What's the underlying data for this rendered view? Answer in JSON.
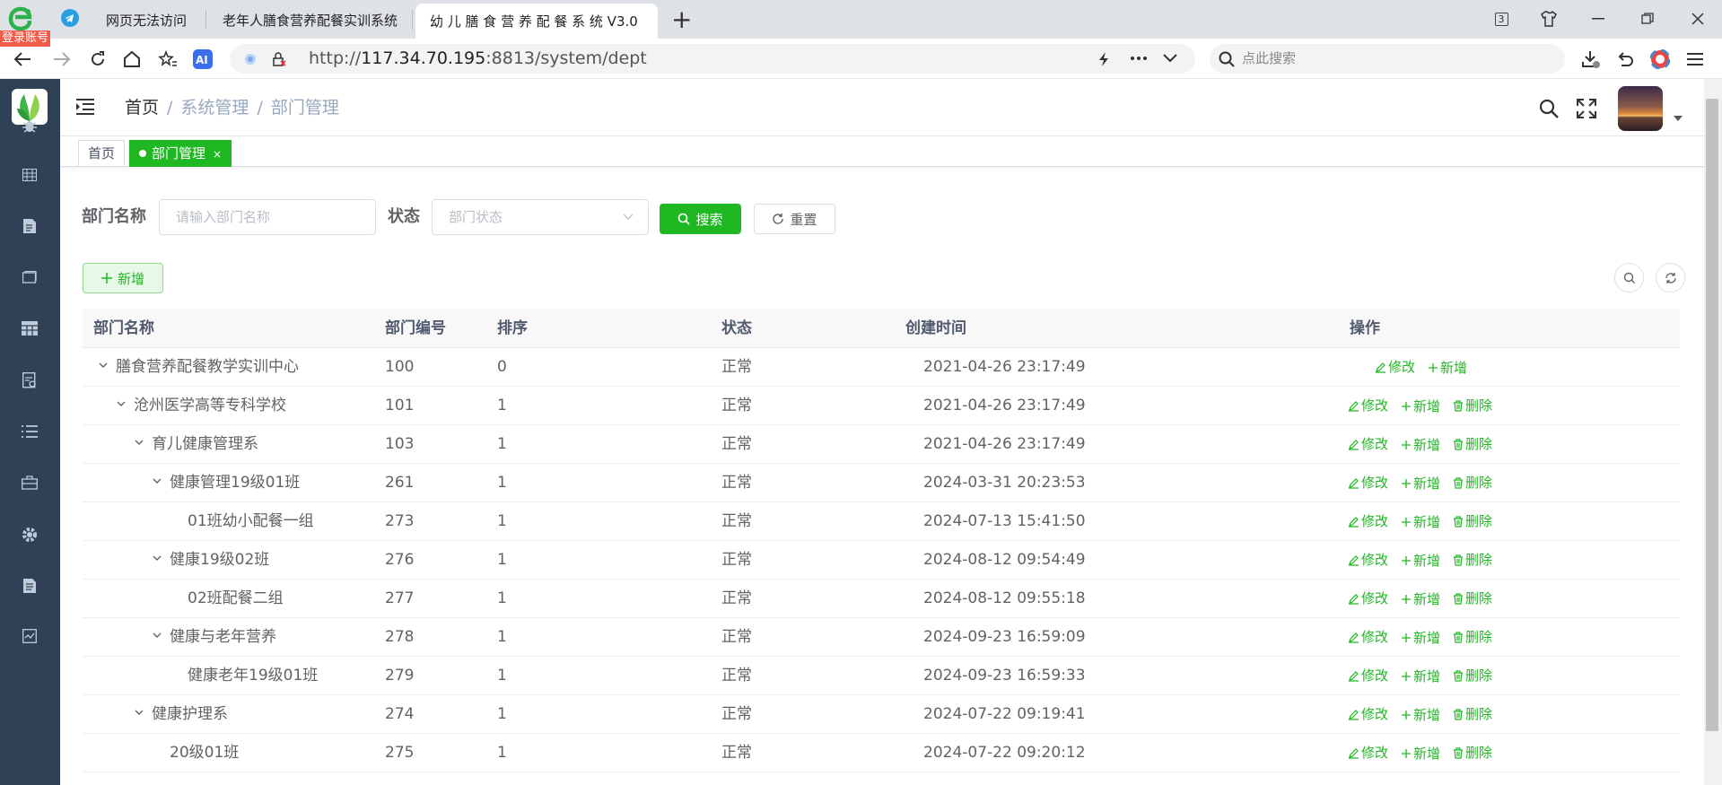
{
  "browser": {
    "login_badge": "登录账号",
    "tabs": [
      {
        "label": "网页无法访问"
      },
      {
        "label": "老年人膳食营养配餐实训系统"
      },
      {
        "label": "幼 儿 膳 食 营 养 配 餐 系 统 V3.0"
      }
    ],
    "tab_count": "3",
    "url_prefix": "http://",
    "url_host": "117.34.70.195",
    "url_rest": ":8813/system/dept",
    "search_placeholder": "点此搜索"
  },
  "breadcrumb": {
    "home": "首页",
    "sep": "/",
    "section": "系统管理",
    "page": "部门管理"
  },
  "tags": {
    "home": "首页",
    "active": "部门管理",
    "close": "×"
  },
  "form": {
    "name_label": "部门名称",
    "name_placeholder": "请输入部门名称",
    "status_label": "状态",
    "status_placeholder": "部门状态",
    "search_btn": "搜索",
    "reset_btn": "重置",
    "add_btn": "新增"
  },
  "table": {
    "headers": {
      "name": "部门名称",
      "id": "部门编号",
      "order": "排序",
      "status": "状态",
      "created": "创建时间",
      "ops": "操作"
    },
    "op_labels": {
      "edit": "修改",
      "add": "新增",
      "delete": "删除"
    },
    "rows": [
      {
        "name": "膳食营养配餐教学实训中心",
        "id": "100",
        "order": "0",
        "status": "正常",
        "created": "2021-04-26 23:17:49",
        "level": 0,
        "expanded": true,
        "can_delete": false
      },
      {
        "name": "沧州医学高等专科学校",
        "id": "101",
        "order": "1",
        "status": "正常",
        "created": "2021-04-26 23:17:49",
        "level": 1,
        "expanded": true,
        "can_delete": true
      },
      {
        "name": "育儿健康管理系",
        "id": "103",
        "order": "1",
        "status": "正常",
        "created": "2021-04-26 23:17:49",
        "level": 2,
        "expanded": true,
        "can_delete": true
      },
      {
        "name": "健康管理19级01班",
        "id": "261",
        "order": "1",
        "status": "正常",
        "created": "2024-03-31 20:23:53",
        "level": 3,
        "expanded": true,
        "can_delete": true
      },
      {
        "name": "01班幼小配餐一组",
        "id": "273",
        "order": "1",
        "status": "正常",
        "created": "2024-07-13 15:41:50",
        "level": 4,
        "expanded": false,
        "can_delete": true
      },
      {
        "name": "健康19级02班",
        "id": "276",
        "order": "1",
        "status": "正常",
        "created": "2024-08-12 09:54:49",
        "level": 3,
        "expanded": true,
        "can_delete": true
      },
      {
        "name": "02班配餐二组",
        "id": "277",
        "order": "1",
        "status": "正常",
        "created": "2024-08-12 09:55:18",
        "level": 4,
        "expanded": false,
        "can_delete": true
      },
      {
        "name": "健康与老年营养",
        "id": "278",
        "order": "1",
        "status": "正常",
        "created": "2024-09-23 16:59:09",
        "level": 3,
        "expanded": true,
        "can_delete": true
      },
      {
        "name": "健康老年19级01班",
        "id": "279",
        "order": "1",
        "status": "正常",
        "created": "2024-09-23 16:59:33",
        "level": 4,
        "expanded": false,
        "can_delete": true
      },
      {
        "name": "健康护理系",
        "id": "274",
        "order": "1",
        "status": "正常",
        "created": "2024-07-22 09:19:41",
        "level": 2,
        "expanded": true,
        "can_delete": true
      },
      {
        "name": "20级01班",
        "id": "275",
        "order": "1",
        "status": "正常",
        "created": "2024-07-22 09:20:12",
        "level": 3,
        "expanded": false,
        "can_delete": true
      }
    ]
  },
  "colors": {
    "primary": "#1fb822",
    "sidebar": "#304156"
  }
}
